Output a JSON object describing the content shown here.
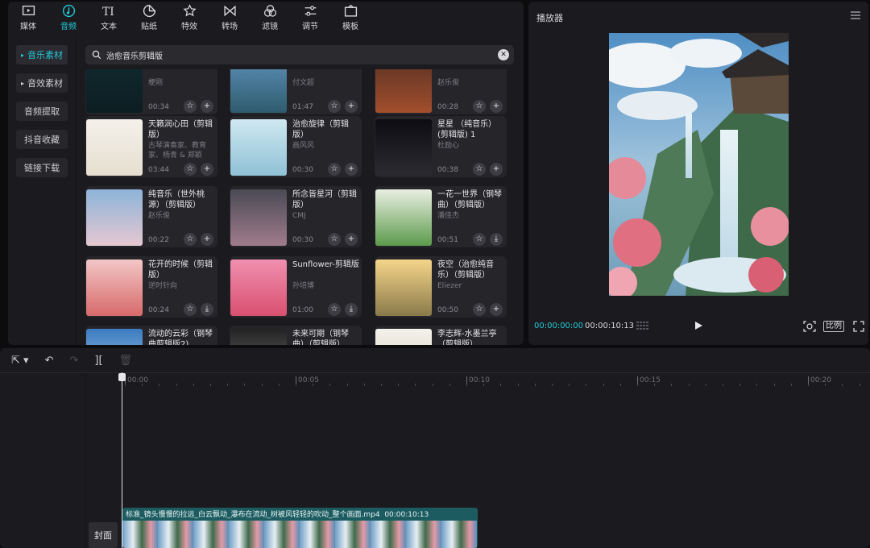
{
  "toolbar": {
    "tabs": [
      {
        "label": "媒体",
        "icon": "media-icon"
      },
      {
        "label": "音频",
        "icon": "audio-icon"
      },
      {
        "label": "文本",
        "icon": "text-icon"
      },
      {
        "label": "贴纸",
        "icon": "sticker-icon"
      },
      {
        "label": "特效",
        "icon": "effects-icon"
      },
      {
        "label": "转场",
        "icon": "transition-icon"
      },
      {
        "label": "滤镜",
        "icon": "filter-icon"
      },
      {
        "label": "调节",
        "icon": "adjust-icon"
      },
      {
        "label": "模板",
        "icon": "template-icon"
      }
    ],
    "active_tab": "音频"
  },
  "sidebar": {
    "items": [
      {
        "label": "音乐素材"
      },
      {
        "label": "音效素材"
      },
      {
        "label": "音频提取"
      },
      {
        "label": "抖音收藏"
      },
      {
        "label": "链接下载"
      }
    ]
  },
  "search": {
    "value": "治愈音乐剪辑版"
  },
  "cards": [
    {
      "title": "",
      "artist": "梗刚",
      "duration": "00:34",
      "action": "add"
    },
    {
      "title": "",
      "artist": "付文超",
      "duration": "01:47",
      "action": "add"
    },
    {
      "title": "",
      "artist": "赵乐俊",
      "duration": "00:28",
      "action": "add"
    },
    {
      "title": "天籁润心田（剪辑版）",
      "artist": "古琴演奏家、教育家、杨青 & 郑颖",
      "duration": "03:44",
      "action": "add"
    },
    {
      "title": "治愈旋律（剪辑版）",
      "artist": "画风风",
      "duration": "00:30",
      "action": "add"
    },
    {
      "title": "星星 （纯音乐）(剪辑版) 1",
      "artist": "杜励心",
      "duration": "00:38",
      "action": "add"
    },
    {
      "title": "纯音乐（世外桃源）（剪辑版）",
      "artist": "赵乐俊",
      "duration": "00:22",
      "action": "add"
    },
    {
      "title": "所念皆星河（剪辑版）",
      "artist": "CMJ",
      "duration": "00:30",
      "action": "add"
    },
    {
      "title": "一花一世界（钢琴曲）（剪辑版）",
      "artist": "潘佳杰",
      "duration": "00:51",
      "action": "download"
    },
    {
      "title": "花开的时候（剪辑版）",
      "artist": "逆时针向",
      "duration": "00:24",
      "action": "download"
    },
    {
      "title": "Sunflower-剪辑版",
      "artist": "孙培博",
      "duration": "01:00",
      "action": "download"
    },
    {
      "title": "夜空（治愈纯音乐）（剪辑版）",
      "artist": "Eliezer",
      "duration": "00:50",
      "action": "add"
    },
    {
      "title": "流动的云彩（钢琴曲剪辑版2)",
      "artist": "",
      "duration": "",
      "action": "add"
    },
    {
      "title": "未来可期（钢琴曲）（剪辑版）",
      "artist": "",
      "duration": "",
      "action": "add"
    },
    {
      "title": "李志辉-水墨兰亭（剪辑版）",
      "artist": "",
      "duration": "",
      "action": "add"
    }
  ],
  "player": {
    "title": "播放器",
    "current_time": "00:00:00:00",
    "total_time": "00:00:10:13",
    "ratio_label": "比例"
  },
  "timeline": {
    "ruler": [
      "00:00",
      "00:05",
      "00:10",
      "00:15",
      "00:20"
    ],
    "cover_label": "封面",
    "clip_label": "标准_镜头慢慢的拉远_白云飘动_瀑布在流动_树被风轻轻的吹动_整个画面.mp4",
    "clip_duration": "00:00:10:13"
  },
  "colors": {
    "accent": "#21c8d6",
    "panel": "#1b1b1f",
    "clip": "#1c5b60"
  }
}
